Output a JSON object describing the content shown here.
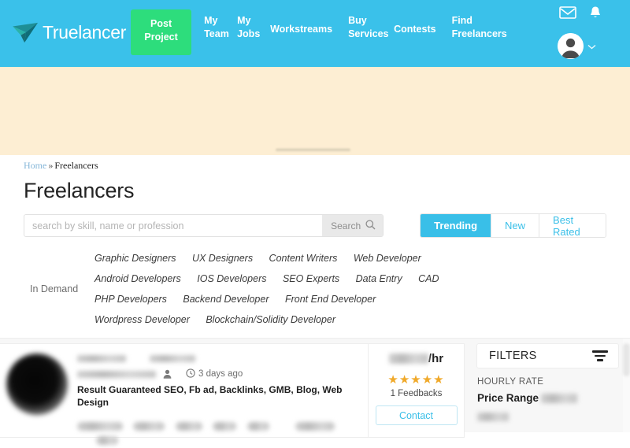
{
  "header": {
    "logo_text": "Truelancer",
    "nav": [
      {
        "label": "Post Project",
        "type": "button"
      },
      {
        "label": "My Team",
        "type": "link"
      },
      {
        "label": "My Jobs",
        "type": "link"
      },
      {
        "label": "Workstreams",
        "type": "link"
      },
      {
        "label": "Buy Services",
        "type": "link"
      },
      {
        "label": "Contests",
        "type": "link"
      },
      {
        "label": "Find Freelancers",
        "type": "link"
      }
    ],
    "icons": {
      "mail": "mail-icon",
      "bell": "bell-icon",
      "avatar": "avatar",
      "chevron": "chevron-down-icon"
    },
    "colors": {
      "bar": "#3ac1ea",
      "post_button": "#2ddd7c",
      "banner": "#fdeed3"
    }
  },
  "breadcrumb": {
    "home": "Home",
    "separator": "»",
    "current": "Freelancers"
  },
  "page_title": "Freelancers",
  "search": {
    "placeholder": "search by skill, name or profession",
    "value": "",
    "button_label": "Search",
    "button_icon": "search-icon"
  },
  "tabs": [
    {
      "label": "Trending",
      "active": true
    },
    {
      "label": "New",
      "active": false
    },
    {
      "label": "Best Rated",
      "active": false
    }
  ],
  "in_demand": {
    "label": "In Demand",
    "lines": [
      [
        "Graphic Designers",
        "UX Designers",
        "Content Writers",
        "Web Developer"
      ],
      [
        "Android Developers",
        "IOS Developers",
        "SEO Experts",
        "Data Entry",
        "CAD"
      ],
      [
        "PHP Developers",
        "Backend Developer",
        "Front End Developer"
      ],
      [
        "Wordpress Developer",
        "Blockchain/Solidity Developer"
      ]
    ]
  },
  "result_card": {
    "name_redacted": true,
    "location_redacted": true,
    "verified_icon": "person-icon",
    "time_icon": "clock-icon",
    "posted": "3 days ago",
    "title": "Result Guaranteed SEO, Fb ad, Backlinks, GMB, Blog, Web Design",
    "skills_redacted": true,
    "rate_redacted": true,
    "rate_suffix": "/hr",
    "stars": 5,
    "star_glyph": "★",
    "star_color": "#f0a92a",
    "feedbacks": "1 Feedbacks",
    "contact_label": "Contact"
  },
  "filters": {
    "title": "FILTERS",
    "icon": "filter-icon",
    "hourly_rate_label": "HOURLY RATE",
    "price_range_label": "Price Range",
    "price_range_value_redacted": true
  }
}
